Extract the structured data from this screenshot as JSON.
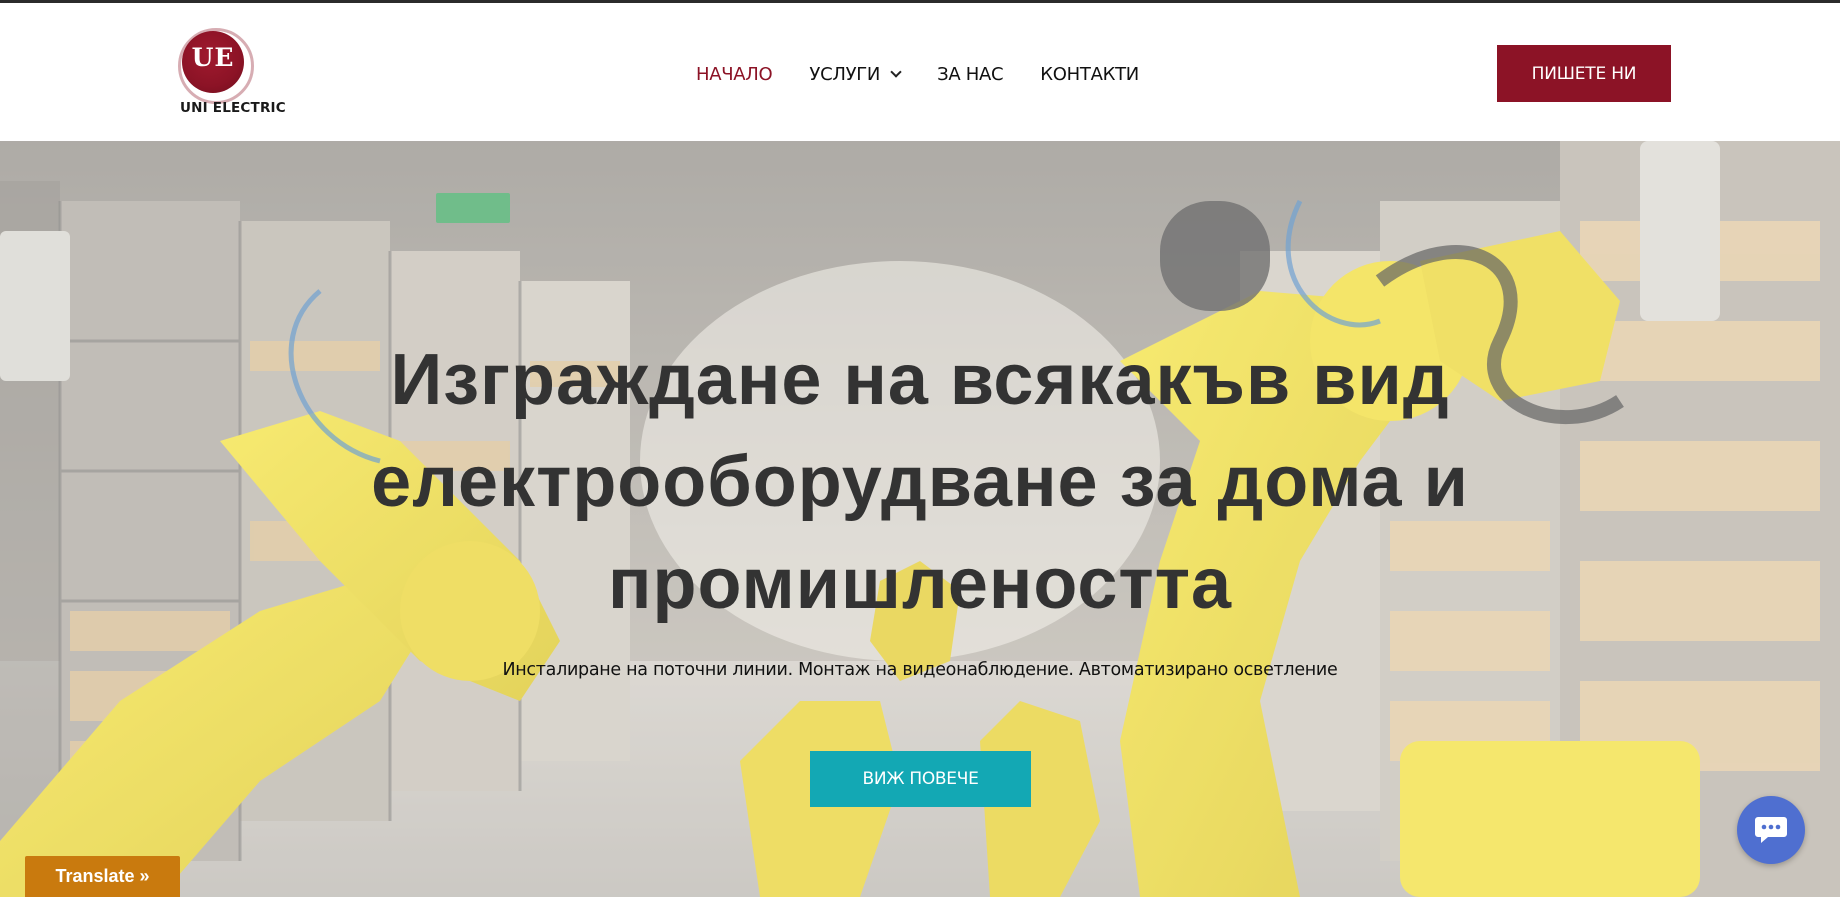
{
  "header": {
    "logo": {
      "initials": "UE",
      "name": "UNI ELECTRIC"
    },
    "nav": [
      {
        "label": "НАЧАЛО",
        "active": true
      },
      {
        "label": "УСЛУГИ",
        "has_dropdown": true
      },
      {
        "label": "ЗА НАС"
      },
      {
        "label": "КОНТАКТИ"
      }
    ],
    "cta_label": "ПИШЕТЕ НИ"
  },
  "hero": {
    "title_lines": [
      "Изграждане на всякакъв вид",
      "електрооборудване за дома и",
      "промишлеността"
    ],
    "subtitle": "Инсталиране на поточни линии. Монтаж на видеонаблюдение. Автоматизирано осветление",
    "cta_label": "ВИЖ ПОВЕЧЕ"
  },
  "widgets": {
    "translate_label": "Translate »",
    "chat_icon": "chat-icon"
  },
  "colors": {
    "brand": "#8c1326",
    "accent": "#13a8b4",
    "translate": "#c97a0e",
    "chat": "#4f6fd0"
  }
}
